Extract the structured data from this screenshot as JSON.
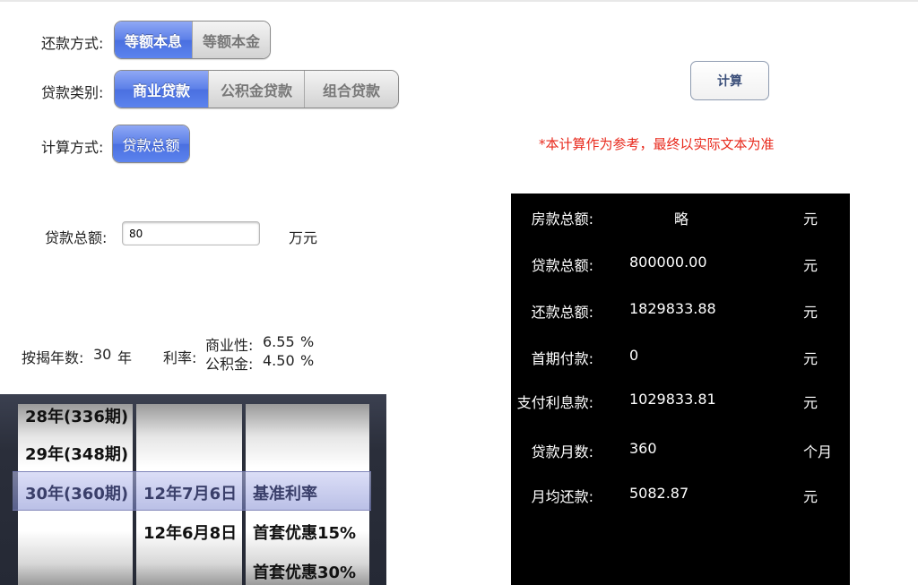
{
  "repay_method": {
    "label": "还款方式:",
    "options": [
      "等额本息",
      "等额本金"
    ],
    "selected": "等额本息"
  },
  "loan_type": {
    "label": "贷款类别:",
    "options": [
      "商业贷款",
      "公积金贷款",
      "组合贷款"
    ],
    "selected": "商业贷款"
  },
  "calc_method": {
    "label": "计算方式:",
    "options": [
      "贷款总额"
    ],
    "selected": "贷款总额"
  },
  "calculate_button": "计算",
  "note": "*本计算作为参考，最终以实际文本为准",
  "loan_total": {
    "label": "贷款总额:",
    "value": "80",
    "unit": "万元"
  },
  "years": {
    "label": "按揭年数:",
    "value": "30",
    "unit": "年"
  },
  "rate": {
    "label": "利率:",
    "commercial_label": "商业性:",
    "commercial_value": "6.55",
    "commercial_unit": "%",
    "fund_label": "公积金:",
    "fund_value": "4.50",
    "fund_unit": "%"
  },
  "results": [
    {
      "label": "房款总额:",
      "value": "略",
      "unit": "元"
    },
    {
      "label": "贷款总额:",
      "value": "800000.00",
      "unit": "元"
    },
    {
      "label": "还款总额:",
      "value": "1829833.88",
      "unit": "元"
    },
    {
      "label": "首期付款:",
      "value": "0",
      "unit": "元"
    },
    {
      "label": "支付利息款:",
      "value": "1029833.81",
      "unit": "元"
    },
    {
      "label": "贷款月数:",
      "value": "360",
      "unit": "个月"
    },
    {
      "label": "月均还款:",
      "value": "5082.87",
      "unit": "元"
    }
  ],
  "picker": {
    "years_column": [
      "28年(336期)",
      "29年(348期)",
      "30年(360期)"
    ],
    "date_column": [
      "12年7月6日",
      "12年6月8日"
    ],
    "rate_column": [
      "基准利率",
      "首套优惠15%",
      "首套优惠30%"
    ],
    "selected": {
      "years": "30年(360期)",
      "date": "12年7月6日",
      "rate": "基准利率"
    }
  }
}
